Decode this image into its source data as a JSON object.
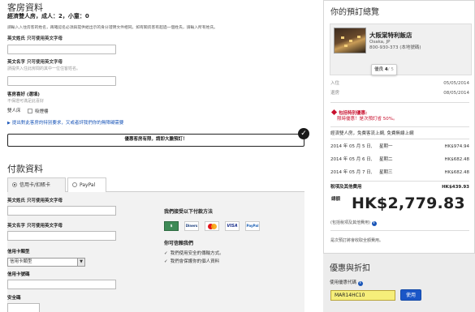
{
  "guest": {
    "section_title": "客房資料",
    "room_summary": "經濟雙人房，成人：2，小童：0",
    "instructions": "請輸入入住房客的姓名，再確認名必須與提供給出示的身分證明文件相同。如有關房客有超過一個姓氏，請輸入所有姓氏。",
    "first_name_label": "英文姓氏",
    "first_name_hint": "只可使用英文字母",
    "last_name_label": "英文名字",
    "last_name_hint": "只可使用英文字母",
    "last_name_sub": "請提供入住此房間的其中一位住客姓名。",
    "pref_label": "客房喜好 (選填)",
    "pref_sub": "不保證可滿足此喜好",
    "bed_label": "雙人床",
    "smoking_label": "吸煙樓",
    "special_link": "提出對此客房的特別要求，又或者評我們你的無障礙需要"
  },
  "deal_banner": "優惠客房有限，請即大膽預訂！",
  "payment": {
    "section_title": "付款資料",
    "tab_card": "信用卡/扣賬卡",
    "tab_paypal": "PayPal",
    "first_name_label": "英文姓氏",
    "first_name_hint": "只可使用英文字母",
    "last_name_label": "英文名字",
    "last_name_hint": "只可使用英文字母",
    "card_type_label": "信用卡類型",
    "card_type_value": "信用卡類型",
    "card_number_label": "信用卡號碼",
    "security_label": "安全碼",
    "accept_title": "我們接受以下付款方法",
    "logos": [
      "$",
      "Diners",
      "MC",
      "VISA",
      "PayPal"
    ],
    "trust_title": "你可信賴我們",
    "trust_points": [
      "我們使用安全的傳輸方式。",
      "我們會保護你的個人資料"
    ]
  },
  "summary": {
    "title": "你的預訂總覽",
    "hotel_name": "大阪棠特利飯店",
    "location": "Osaka, JP",
    "phone": "800-930-373 (本地號碼)",
    "rating_label": "優良",
    "rating_value": "4",
    "rating_max": "/ 5",
    "checkin_label": "入住",
    "checkin_date": "05/05/2014",
    "checkout_label": "退房",
    "checkout_date": "08/05/2014",
    "deal_title": "包括特別優惠:",
    "deal_text": "限時優惠！是次預訂省 50%。",
    "room_line": "經濟雙人房，免費客流上網, 免費無線上網",
    "nights": [
      {
        "date": "2014 年 05 月 5 日,",
        "day": "星期一",
        "amount": "HK$974.94"
      },
      {
        "date": "2014 年 05 月 6 日,",
        "day": "星期二",
        "amount": "HK$682.48"
      },
      {
        "date": "2014 年 05 月 7 日,",
        "day": "星期三",
        "amount": "HK$682.48"
      }
    ],
    "tax_label": "稅項及其他費用",
    "tax_amount": "HK$439.93",
    "total_label": "總額",
    "total_amount": "HK$2,779.83",
    "total_note": "(包括稅項及其他費用)",
    "room_note": "是次預訂將會收取全額費用。"
  },
  "promo": {
    "title": "優惠與折扣",
    "label": "使用優惠代碼",
    "code": "MAR14HC10",
    "button": "使用"
  },
  "colors": {
    "link": "#1a56b8",
    "deal_red": "#c8102e",
    "promo_bg": "#f6ee7a",
    "button_blue": "#1a56c7"
  }
}
